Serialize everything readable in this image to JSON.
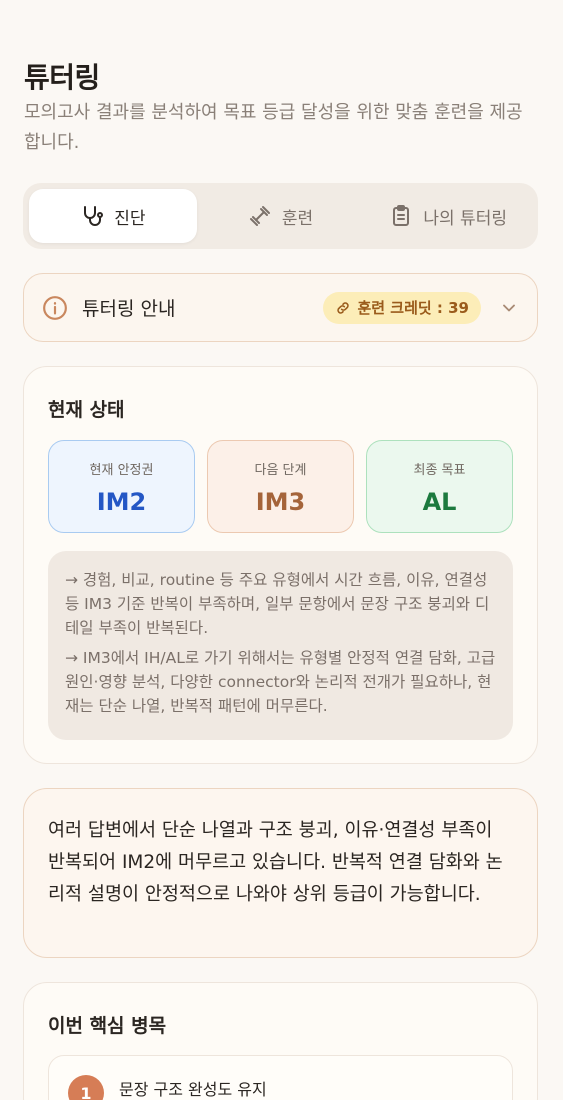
{
  "header": {
    "title": "튜터링",
    "subtitle": "모의고사 결과를 분석하여 목표 등급 달성을 위한 맞춤 훈련을 제공합니다."
  },
  "tabs": [
    {
      "label": "진단",
      "icon": "stethoscope-icon",
      "active": true
    },
    {
      "label": "훈련",
      "icon": "dumbbell-icon",
      "active": false
    },
    {
      "label": "나의 튜터링",
      "icon": "clipboard-icon",
      "active": false
    }
  ],
  "guide": {
    "label": "튜터링 안내",
    "credit": "훈련 크레딧 : 39",
    "icon": "info-icon"
  },
  "status": {
    "title": "현재 상태",
    "grades": [
      {
        "label": "현재 안정권",
        "value": "IM2"
      },
      {
        "label": "다음 단계",
        "value": "IM3"
      },
      {
        "label": "최종 목표",
        "value": "AL"
      }
    ],
    "notes": [
      "→ 경험, 비교, routine 등 주요 유형에서 시간 흐름, 이유, 연결성 등 IM3 기준 반복이 부족하며, 일부 문항에서 문장 구조 붕괴와 디테일 부족이 반복된다.",
      "→ IM3에서 IH/AL로 가기 위해서는 유형별 안정적 연결 담화, 고급 원인·영향 분석, 다양한 connector와 논리적 전개가 필요하나, 현재는 단순 나열, 반복적 패턴에 머무른다."
    ]
  },
  "summary": {
    "text": "여러 답변에서 단순 나열과 구조 붕괴, 이유·연결성 부족이 반복되어 IM2에 머무르고 있습니다. 반복적 연결 담화와 논리적 설명이 안정적으로 나와야 상위 등급이 가능합니다."
  },
  "bottleneck": {
    "title": "이번 핵심 병목",
    "items": [
      {
        "number": "1",
        "title": "문장 구조 완성도 유지"
      }
    ]
  },
  "colors": {
    "accent": "#d67d56",
    "background": "#fbf8f4",
    "current_grade": "#2457c5",
    "next_grade": "#a5643a",
    "goal_grade": "#1c7a3e"
  }
}
